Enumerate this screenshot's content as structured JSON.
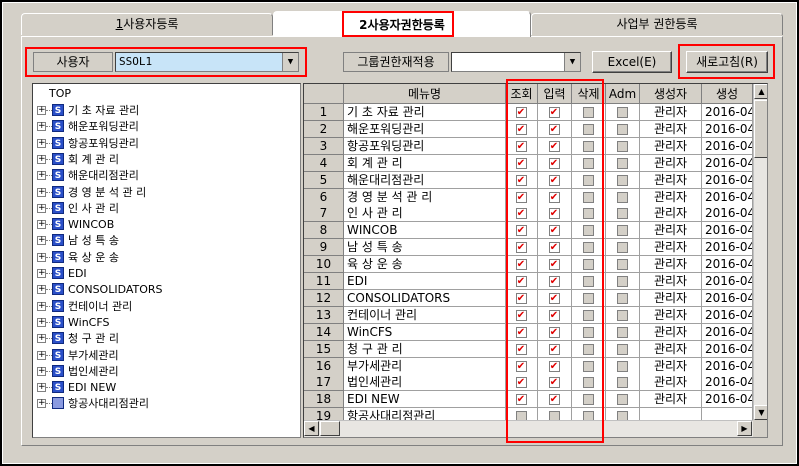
{
  "tabs": [
    {
      "num": "1",
      "label": "사용자등록",
      "active": false
    },
    {
      "num": "2",
      "label": "사용자권한등록",
      "active": true
    },
    {
      "num": "",
      "label": "사업부 권한등록",
      "active": false
    }
  ],
  "toolbar": {
    "user_label": "사용자",
    "user_value": "SSOL1",
    "group_label": "그룹권한재적용",
    "group_value": "",
    "excel_label": "Excel(E)",
    "refresh_label": "새로고침(R)"
  },
  "tree": {
    "root": "TOP",
    "items": [
      "기 초 자료 관리",
      "해운포워딩관리",
      "항공포워딩관리",
      "회 계 관 리",
      "해운대리점관리",
      "경 영 분 석 관 리",
      "인 사 관 리",
      "WINCOB",
      "남 성 특 송",
      "육 상 운 송",
      "EDI",
      "CONSOLIDATORS",
      "컨테이너 관리",
      "WinCFS",
      "청 구 관 리",
      "부가세관리",
      "법인세관리",
      "EDI NEW",
      "항공사대리점관리"
    ]
  },
  "grid": {
    "headers": [
      "",
      "메뉴명",
      "조회",
      "입력",
      "삭제",
      "Adm",
      "생성자",
      "생성"
    ],
    "rows": [
      {
        "no": "1",
        "menu": "기 초 자료 관리",
        "creator": "관리자",
        "date": "2016-04"
      },
      {
        "no": "2",
        "menu": "해운포워딩관리",
        "creator": "관리자",
        "date": "2016-04"
      },
      {
        "no": "3",
        "menu": "항공포워딩관리",
        "creator": "관리자",
        "date": "2016-04"
      },
      {
        "no": "4",
        "menu": "회 계 관 리",
        "creator": "관리자",
        "date": "2016-04"
      },
      {
        "no": "5",
        "menu": "해운대리점관리",
        "creator": "관리자",
        "date": "2016-04"
      },
      {
        "no": "6",
        "menu": "경 영 분 석 관 리",
        "creator": "관리자",
        "date": "2016-04"
      },
      {
        "no": "7",
        "menu": "인 사 관 리",
        "creator": "관리자",
        "date": "2016-04"
      },
      {
        "no": "8",
        "menu": "WINCOB",
        "creator": "관리자",
        "date": "2016-04"
      },
      {
        "no": "9",
        "menu": "남 성 특 송",
        "creator": "관리자",
        "date": "2016-04"
      },
      {
        "no": "10",
        "menu": "육 상 운 송",
        "creator": "관리자",
        "date": "2016-04"
      },
      {
        "no": "11",
        "menu": "EDI",
        "creator": "관리자",
        "date": "2016-04"
      },
      {
        "no": "12",
        "menu": "CONSOLIDATORS",
        "creator": "관리자",
        "date": "2016-04"
      },
      {
        "no": "13",
        "menu": "컨테이너 관리",
        "creator": "관리자",
        "date": "2016-04"
      },
      {
        "no": "14",
        "menu": "WinCFS",
        "creator": "관리자",
        "date": "2016-04"
      },
      {
        "no": "15",
        "menu": "청 구 관 리",
        "creator": "관리자",
        "date": "2016-04"
      },
      {
        "no": "16",
        "menu": "부가세관리",
        "creator": "관리자",
        "date": "2016-04"
      },
      {
        "no": "17",
        "menu": "법인세관리",
        "creator": "관리자",
        "date": "2016-04"
      },
      {
        "no": "18",
        "menu": "EDI NEW",
        "creator": "관리자",
        "date": "2016-04"
      },
      {
        "no": "19",
        "menu": "항공사대리점관리",
        "creator": "",
        "date": ""
      }
    ]
  },
  "colors": {
    "highlight": "#ff0000",
    "check": "#e00000",
    "face": "#d4d0c8"
  }
}
